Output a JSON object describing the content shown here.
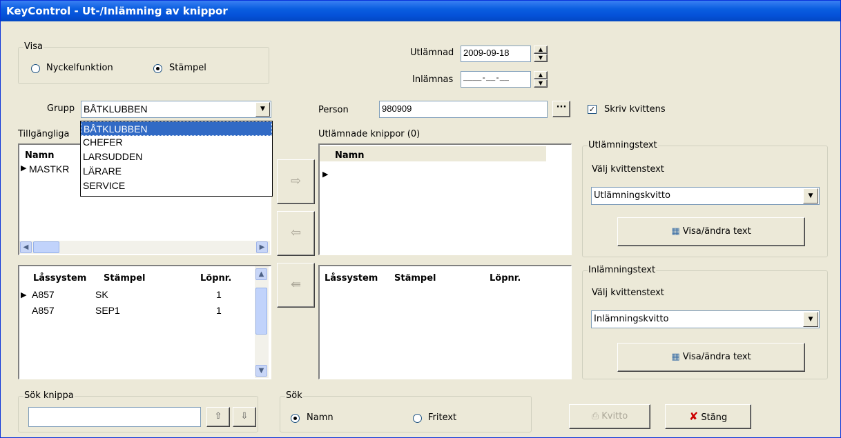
{
  "window": {
    "title": "KeyControl - Ut-/Inlämning av knippor"
  },
  "visa": {
    "label": "Visa",
    "opt_nyckel": "Nyckelfunktion",
    "opt_stampel": "Stämpel",
    "selected": "Stämpel"
  },
  "dates": {
    "utlamnad_label": "Utlämnad",
    "utlamnad_value": "2009-09-18",
    "inlamnas_label": "Inlämnas",
    "inlamnas_value": "____-__-__"
  },
  "grupp": {
    "label": "Grupp",
    "value": "BÅTKLUBBEN",
    "options": [
      "BÅTKLUBBEN",
      "CHEFER",
      "LARSUDDEN",
      "LÄRARE",
      "SERVICE"
    ]
  },
  "available": {
    "label": "Tillgängliga",
    "column": "Namn",
    "rows": [
      "MASTKR"
    ]
  },
  "locks_left": {
    "columns": [
      "Låssystem",
      "Stämpel",
      "Löpnr."
    ],
    "rows": [
      [
        "A857",
        "SK",
        "1"
      ],
      [
        "A857",
        "SEP1",
        "1"
      ]
    ]
  },
  "person": {
    "label": "Person",
    "value": "980909",
    "browse_label": "···"
  },
  "skriv_kvittens": {
    "label": "Skriv kvittens",
    "checked": true
  },
  "handed_out": {
    "label": "Utlämnade knippor (0)",
    "column": "Namn"
  },
  "locks_right": {
    "columns": [
      "Låssystem",
      "Stämpel",
      "Löpnr."
    ]
  },
  "utlamningstext": {
    "group_label": "Utlämningstext",
    "choose_label": "Välj kvittenstext",
    "value": "Utlämningskvitto",
    "button": "Visa/ändra text"
  },
  "inlamningstext": {
    "group_label": "Inlämningstext",
    "choose_label": "Välj kvittenstext",
    "value": "Inlämningskvitto",
    "button": "Visa/ändra text"
  },
  "sok_knippa": {
    "label": "Sök knippa",
    "value": ""
  },
  "sok": {
    "label": "Sök",
    "opt_namn": "Namn",
    "opt_fritext": "Fritext",
    "selected": "Namn"
  },
  "buttons": {
    "kvitto": "Kvitto",
    "stang": "Stäng"
  }
}
